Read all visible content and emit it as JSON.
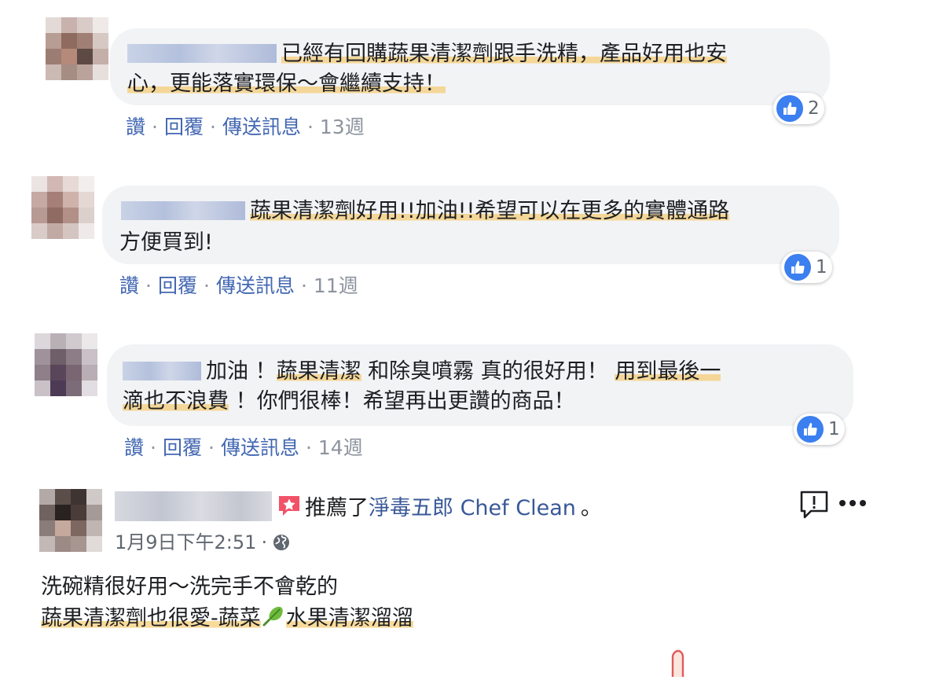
{
  "comments": [
    {
      "text_a": "已經有回購蔬果清潔劑跟手洗精，產品好用也安",
      "text_b": "心，更能落實環保～會繼續支持！",
      "actions": {
        "like": "讚",
        "reply": "回覆",
        "message": "傳送訊息",
        "time": "13週"
      },
      "reactions": "2"
    },
    {
      "text_a": "蔬果清潔劑好用!!加油!!希望可以在更多的實體通路",
      "text_b": "方便買到!",
      "actions": {
        "like": "讚",
        "reply": "回覆",
        "message": "傳送訊息",
        "time": "11週"
      },
      "reactions": "1"
    },
    {
      "text_a_1": "加油  ！",
      "text_a_2": "蔬果清潔",
      "text_a_3": " 和除臭噴霧 真的很好用！ ",
      "text_a_4": "用到最後一",
      "text_b_1": "滴也不浪費",
      "text_b_2": " ！你們很棒！希望再出更讚的商品！",
      "actions": {
        "like": "讚",
        "reply": "回覆",
        "message": "傳送訊息",
        "time": "14週"
      },
      "reactions": "1"
    }
  ],
  "post": {
    "recommend_text": "推薦了",
    "page_name": "淨毒五郎 Chef Clean",
    "end_mark": "。",
    "timestamp": "1月9日下午2:51",
    "meta_sep": "·",
    "line1": "洗碗精很好用～洗完手不會乾的",
    "line2a": "蔬果清潔劑也很愛-蔬菜",
    "line2b": "水果清潔溜溜"
  },
  "icons": {
    "like": "thumbs-up-icon",
    "recommend": "recommend-star-icon",
    "globe": "globe-icon",
    "report": "report-icon",
    "more": "more-icon",
    "vegetable": "leafy-vegetable-icon",
    "hand": "hand-icon"
  },
  "colors": {
    "link": "#4267b2",
    "like": "#3b7ff0",
    "bubble": "#f2f3f5",
    "recommend": "#f25268"
  }
}
